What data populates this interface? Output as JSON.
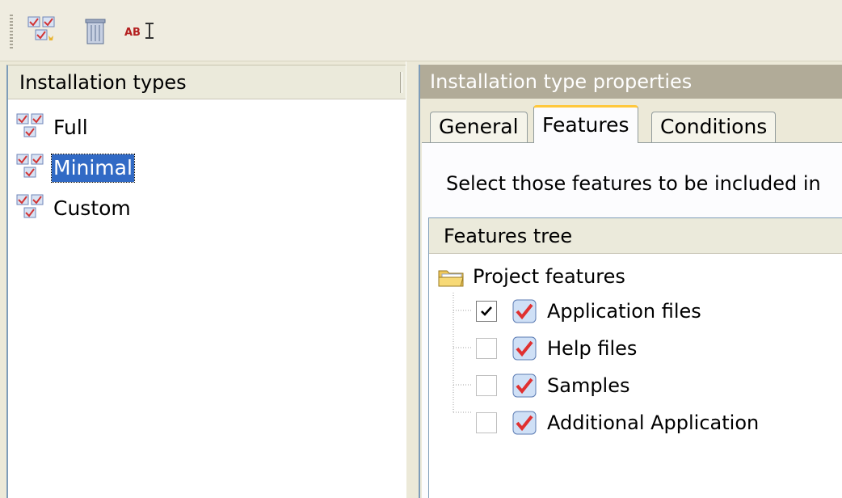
{
  "toolbar": {
    "buttons": [
      {
        "name": "add-installation-type",
        "icon": "add-checklist-icon"
      },
      {
        "name": "delete",
        "icon": "trash-icon"
      },
      {
        "name": "rename",
        "icon": "rename-icon"
      }
    ]
  },
  "left_pane": {
    "header": "Installation types",
    "items": [
      {
        "label": "Full",
        "selected": false
      },
      {
        "label": "Minimal",
        "selected": true
      },
      {
        "label": "Custom",
        "selected": false
      }
    ]
  },
  "right_pane": {
    "header": "Installation type properties",
    "tabs": [
      {
        "label": "General",
        "active": false
      },
      {
        "label": "Features",
        "active": true
      },
      {
        "label": "Conditions",
        "active": false
      }
    ],
    "instruction": "Select those features to be included in",
    "features_tree": {
      "header": "Features tree",
      "root_label": "Project features",
      "items": [
        {
          "label": "Application files",
          "checked": true
        },
        {
          "label": "Help files",
          "checked": false
        },
        {
          "label": "Samples",
          "checked": false
        },
        {
          "label": "Additional Application",
          "checked": false
        }
      ]
    }
  },
  "colors": {
    "selection": "#316ac5",
    "active_tab_accent": "#ffc83c",
    "props_header_bg": "#b1ab98",
    "window_bg": "#ece9d8"
  }
}
